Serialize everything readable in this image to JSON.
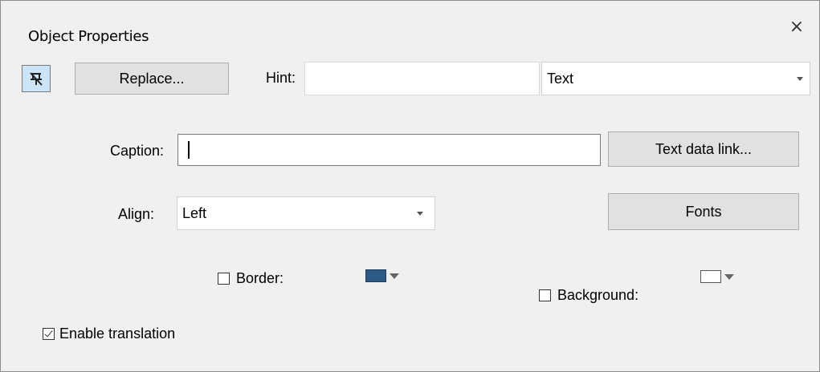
{
  "dialog": {
    "title": "Object Properties",
    "close_glyph": "×"
  },
  "toolbar": {
    "pin_icon": "pin-off-icon",
    "replace_label": "Replace...",
    "hint_label": "Hint:",
    "hint_value": "",
    "type_value": "Text"
  },
  "caption": {
    "label": "Caption:",
    "value": "",
    "text_data_link_label": "Text data link..."
  },
  "align": {
    "label": "Align:",
    "value": "Left",
    "fonts_label": "Fonts"
  },
  "border": {
    "label": "Border:",
    "checked": false,
    "color": "#2b5a85"
  },
  "background": {
    "label": "Background:",
    "checked": false,
    "color": "#ffffff"
  },
  "translation": {
    "label": "Enable translation",
    "checked": true
  }
}
